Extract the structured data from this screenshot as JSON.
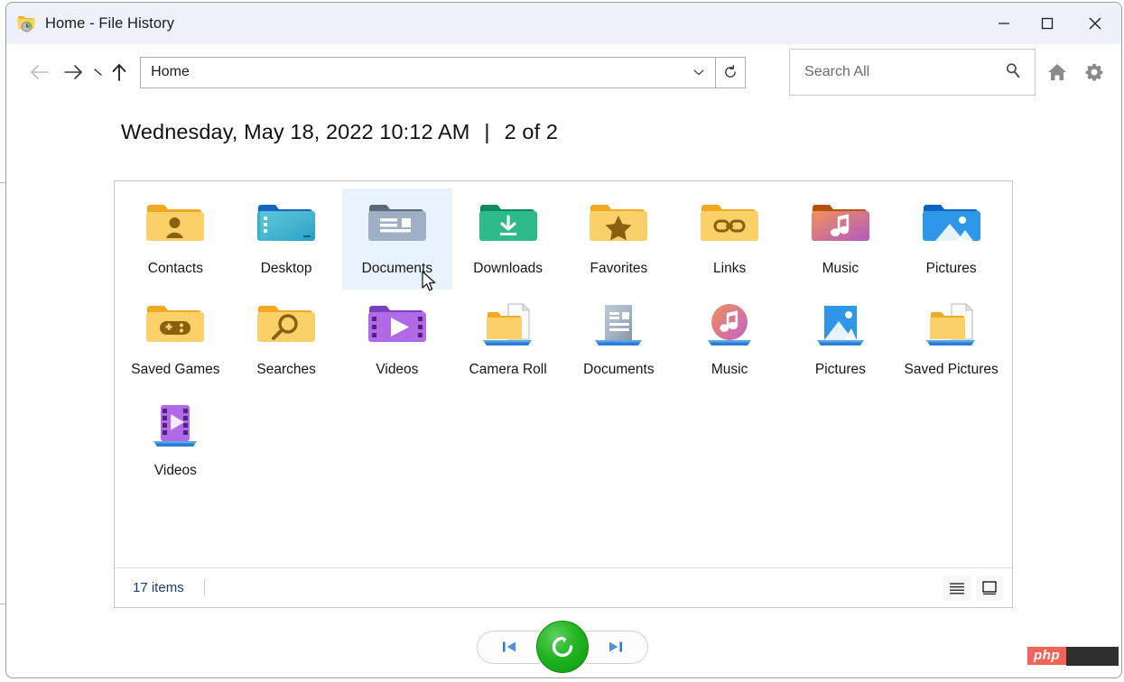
{
  "window": {
    "title": "Home - File History",
    "app_icon": "folder-clock-icon",
    "controls": {
      "minimize": "minimize-icon",
      "maximize": "maximize-icon",
      "close": "close-icon"
    }
  },
  "toolbar": {
    "back": "back-arrow-icon",
    "forward": "forward-arrow-icon",
    "recent": "recent-locations-icon",
    "up": "up-arrow-icon",
    "address_value": "Home",
    "address_dropdown": "chevron-down-icon",
    "refresh": "refresh-icon",
    "search_placeholder": "Search All",
    "search_icon": "search-icon",
    "home_icon": "home-icon",
    "settings_icon": "gear-icon"
  },
  "header": {
    "timestamp": "Wednesday, May 18, 2022 10:12 AM",
    "separator": "|",
    "position": "2 of 2"
  },
  "items": [
    {
      "label": "Contacts",
      "icon": "folder-contacts-icon",
      "selected": false
    },
    {
      "label": "Desktop",
      "icon": "folder-desktop-icon",
      "selected": false
    },
    {
      "label": "Documents",
      "icon": "folder-documents-icon",
      "selected": true
    },
    {
      "label": "Downloads",
      "icon": "folder-downloads-icon",
      "selected": false
    },
    {
      "label": "Favorites",
      "icon": "folder-favorites-icon",
      "selected": false
    },
    {
      "label": "Links",
      "icon": "folder-links-icon",
      "selected": false
    },
    {
      "label": "Music",
      "icon": "folder-music-icon",
      "selected": false
    },
    {
      "label": "Pictures",
      "icon": "folder-pictures-icon",
      "selected": false
    },
    {
      "label": "Saved Games",
      "icon": "folder-games-icon",
      "selected": false
    },
    {
      "label": "Searches",
      "icon": "folder-searches-icon",
      "selected": false
    },
    {
      "label": "Videos",
      "icon": "folder-videos-icon",
      "selected": false
    },
    {
      "label": "Camera Roll",
      "icon": "library-folder-icon",
      "selected": false
    },
    {
      "label": "Documents",
      "icon": "library-documents-icon",
      "selected": false
    },
    {
      "label": "Music",
      "icon": "library-music-icon",
      "selected": false
    },
    {
      "label": "Pictures",
      "icon": "library-pictures-icon",
      "selected": false
    },
    {
      "label": "Saved Pictures",
      "icon": "library-folder-icon",
      "selected": false
    },
    {
      "label": "Videos",
      "icon": "library-videos-icon",
      "selected": false
    }
  ],
  "status": {
    "item_count": "17 items",
    "view_details": "details-view-icon",
    "view_large_icons": "large-icons-view-icon"
  },
  "transport": {
    "previous": "previous-version-icon",
    "restore": "restore-icon",
    "next": "next-version-icon"
  },
  "watermark": {
    "text": "php"
  },
  "colors": {
    "titlebar": "#eef1f9",
    "selection": "#e9f3fd",
    "restore_green": "#21b521",
    "accent_blue": "#2a7fd4",
    "status_text": "#1b3e6f",
    "watermark_red": "#f2645a"
  }
}
